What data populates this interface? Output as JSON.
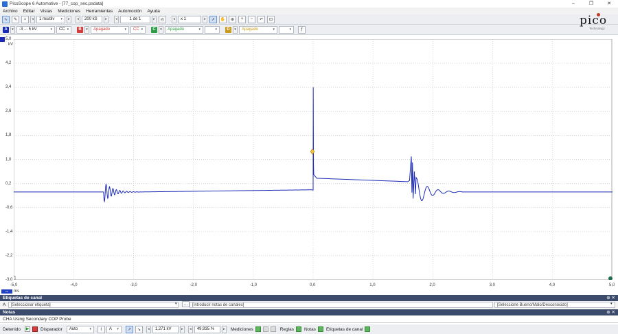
{
  "window": {
    "title": "PicoScope 6 Automotive - [77_cop_sec.psdata]",
    "controls": [
      "–",
      "❐",
      "✕"
    ]
  },
  "menu": [
    "Archivo",
    "Editar",
    "Vistas",
    "Mediciones",
    "Herramientas",
    "Automoción",
    "Ayuda"
  ],
  "toolbar": {
    "timebase": "1 ms/div",
    "samples": "200 kS",
    "buffer": "1 de 1",
    "zoom": "x 1"
  },
  "channels": [
    {
      "id": "A",
      "range": "-3 ... 5 kV",
      "coupling": "CC",
      "color": "#1a2ab6"
    },
    {
      "id": "B",
      "range": "Apagado",
      "coupling": "CC",
      "color": "#d63a3a"
    },
    {
      "id": "C",
      "range": "Apagado",
      "coupling": "",
      "color": "#2e9b45"
    },
    {
      "id": "D",
      "range": "Apagado",
      "coupling": "",
      "color": "#c99a1c"
    }
  ],
  "logo": {
    "text": "pico",
    "subtitle": "Technology"
  },
  "plot": {
    "y_unit": "kV",
    "x_unit": "ms",
    "y_ticks": [
      "5,0",
      "4,2",
      "3,4",
      "2,6",
      "1,8",
      "1,0",
      "0,2",
      "-0,6",
      "-1,4",
      "-2,2",
      "-3,0"
    ],
    "x_ticks": [
      "-5,0",
      "-4,0",
      "-3,0",
      "-2,0",
      "-1,0",
      "0,0",
      "1,0",
      "2,0",
      "3,0",
      "4,0",
      "5,0"
    ],
    "trace_color": "#1a2ab6"
  },
  "channel_labels": {
    "header": "Etiquetas de canal",
    "channel": "A",
    "label_select": "[Seleccionar etiqueta]",
    "notes_placeholder": "[Introducir notas de canales]",
    "quality_select": "[Seleccione Bueno/Malo/Desconocido]"
  },
  "notes": {
    "header": "Notas",
    "text": "CHA Using Secondary COP Probe"
  },
  "statusbar": {
    "state": "Detenido",
    "trigger_label": "Disparador",
    "trigger_mode": "Auto",
    "trigger_channel": "A",
    "trigger_level": "1,271 kV",
    "pretrigger": "49,935 %",
    "measurements": "Mediciones",
    "rulers": "Reglas",
    "notes": "Notas",
    "channel_labels": "Etiquetas de canal"
  }
}
